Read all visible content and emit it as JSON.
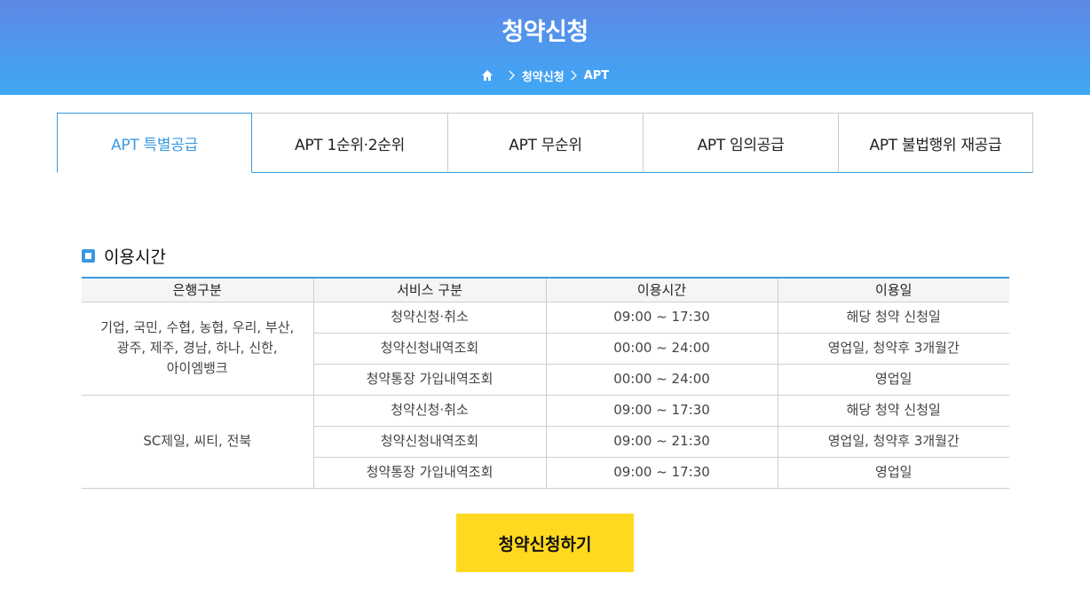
{
  "header": {
    "title": "청약신청",
    "breadcrumb": [
      "청약신청",
      "APT"
    ]
  },
  "tabs": [
    {
      "label": "APT 특별공급",
      "active": true
    },
    {
      "label": "APT 1순위·2순위",
      "active": false
    },
    {
      "label": "APT 무순위",
      "active": false
    },
    {
      "label": "APT 임의공급",
      "active": false
    },
    {
      "label": "APT 불법행위 재공급",
      "active": false
    }
  ],
  "section": {
    "title": "이용시간"
  },
  "table": {
    "headers": [
      "은행구분",
      "서비스 구분",
      "이용시간",
      "이용일"
    ],
    "groups": [
      {
        "bank_lines": [
          "기업, 국민, 수협, 농협, 우리, 부산,",
          "광주, 제주, 경남, 하나, 신한,",
          "아이엠뱅크"
        ],
        "rows": [
          {
            "service": "청약신청·취소",
            "time": "09:00 ~ 17:30",
            "days": "해당 청약 신청일"
          },
          {
            "service": "청약신청내역조회",
            "time": "00:00 ~ 24:00",
            "days": "영업일, 청약후 3개월간"
          },
          {
            "service": "청약통장 가입내역조회",
            "time": "00:00 ~ 24:00",
            "days": "영업일"
          }
        ]
      },
      {
        "bank_lines": [
          "SC제일, 씨티, 전북"
        ],
        "rows": [
          {
            "service": "청약신청·취소",
            "time": "09:00 ~ 17:30",
            "days": "해당 청약 신청일"
          },
          {
            "service": "청약신청내역조회",
            "time": "09:00 ~ 21:30",
            "days": "영업일, 청약후 3개월간"
          },
          {
            "service": "청약통장 가입내역조회",
            "time": "09:00 ~ 17:30",
            "days": "영업일"
          }
        ]
      }
    ]
  },
  "apply_button": {
    "label": "청약신청하기"
  },
  "colors": {
    "header_gradient_top": "#5e88e6",
    "header_gradient_bottom": "#3ea8f5",
    "accent": "#3b9ae1",
    "button": "#ffd91f"
  },
  "icons": {
    "home": "home-icon",
    "separator": "chevron-right-icon",
    "section_marker": "square-bullet-icon"
  }
}
